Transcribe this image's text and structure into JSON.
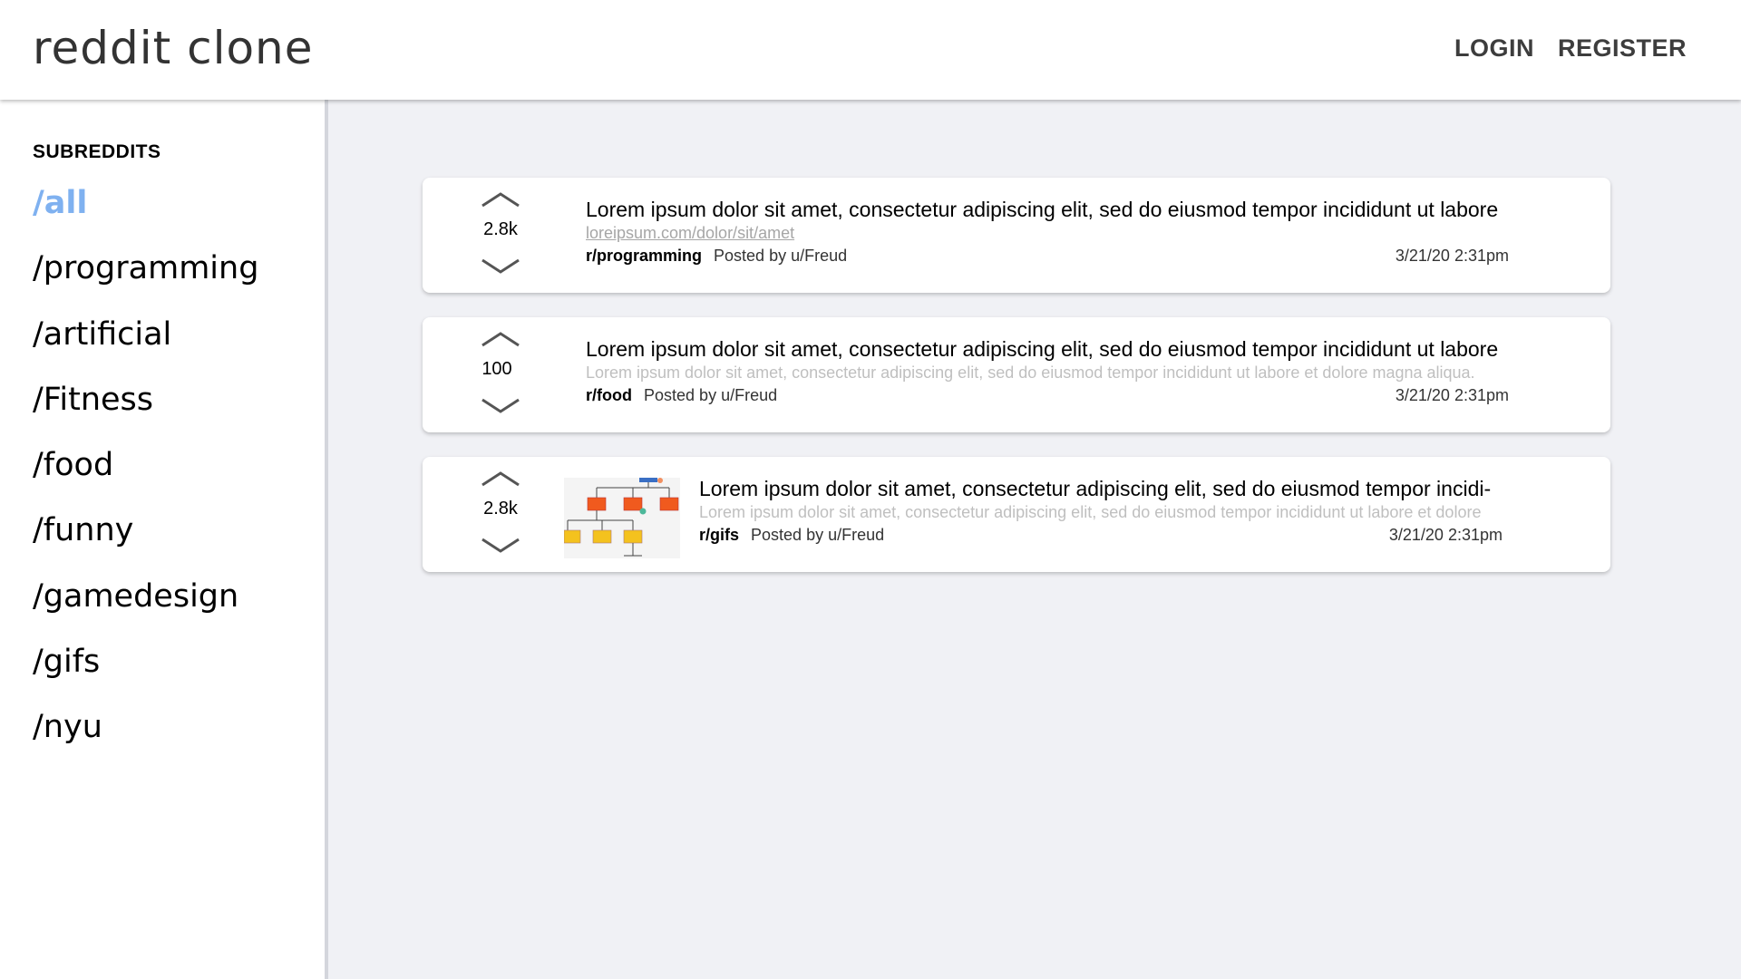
{
  "header": {
    "brand": "reddit clone",
    "login": "LOGIN",
    "register": "REGISTER"
  },
  "sidebar": {
    "heading": "SUBREDDITS",
    "items": [
      {
        "label": "/all",
        "active": true
      },
      {
        "label": "/programming"
      },
      {
        "label": "/artificial"
      },
      {
        "label": "/Fitness"
      },
      {
        "label": "/food"
      },
      {
        "label": "/funny"
      },
      {
        "label": "/gamedesign"
      },
      {
        "label": "/gifs"
      },
      {
        "label": "/nyu"
      }
    ]
  },
  "posts": [
    {
      "votes": "2.8k",
      "title": "Lorem ipsum dolor sit amet, consectetur adipiscing elit, sed do eiusmod tempor incididunt ut labore",
      "link": "loreipsum.com/dolor/sit/amet",
      "subreddit": "r/programming",
      "posted_by": "Posted by u/Freud",
      "time": "3/21/20 2:31pm"
    },
    {
      "votes": "100",
      "title": "Lorem ipsum dolor sit amet, consectetur adipiscing elit, sed do eiusmod tempor incididunt ut labore",
      "text": "Lorem ipsum dolor sit amet, consectetur adipiscing elit, sed do eiusmod tempor incididunt ut labore et dolore magna aliqua.",
      "subreddit": "r/food",
      "posted_by": "Posted by u/Freud",
      "time": "3/21/20 2:31pm"
    },
    {
      "votes": "2.8k",
      "thumbnail": "org-chart-diagram",
      "title": "Lorem ipsum dolor sit amet, consectetur adipiscing elit, sed do eiusmod tempor incidi-",
      "text": "Lorem ipsum dolor sit amet, consectetur adipiscing elit, sed do eiusmod tempor incididunt ut labore et dolore",
      "subreddit": "r/gifs",
      "posted_by": "Posted by u/Freud",
      "time": "3/21/20 2:31pm"
    }
  ],
  "icons": {
    "upvote": "chevron-up-icon",
    "downvote": "chevron-down-icon"
  },
  "colors": {
    "active_subreddit": "#7fb1f0",
    "background": "#f0f1f5"
  }
}
